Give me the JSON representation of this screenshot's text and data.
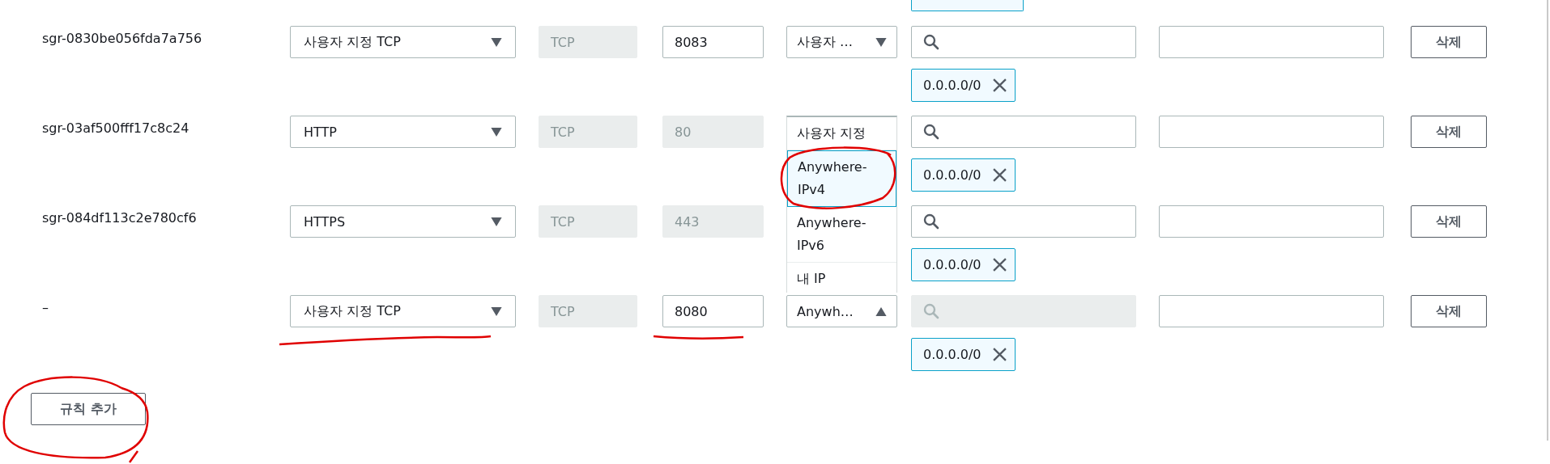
{
  "rules": [
    {
      "id": "sgr-0830be056fda7a756",
      "type": "사용자 지정 TCP",
      "protocol": "TCP",
      "port": {
        "value": "8083",
        "disabled": false
      },
      "source": {
        "value": "사용자 …",
        "expanded": false
      },
      "search_disabled": false,
      "delete": "삭제",
      "tags": [
        {
          "label": "0.0.0.0/0"
        }
      ]
    },
    {
      "id": "sgr-03af500fff17c8c24",
      "type": "HTTP",
      "protocol": "TCP",
      "port": {
        "value": "80",
        "disabled": true
      },
      "search_disabled": false,
      "delete": "삭제",
      "tags": [
        {
          "label": "0.0.0.0/0"
        }
      ]
    },
    {
      "id": "sgr-084df113c2e780cf6",
      "type": "HTTPS",
      "protocol": "TCP",
      "port": {
        "value": "443",
        "disabled": true
      },
      "search_disabled": false,
      "delete": "삭제",
      "tags": [
        {
          "label": "0.0.0.0/0"
        }
      ]
    },
    {
      "id": "–",
      "type": "사용자 지정 TCP",
      "protocol": "TCP",
      "port": {
        "value": "8080",
        "disabled": false
      },
      "source": {
        "value": "Anywh…",
        "expanded": true,
        "options": [
          {
            "label": "사용자 지정",
            "selected": false
          },
          {
            "label": "Anywhere-IPv4",
            "selected": true
          },
          {
            "label": "Anywhere-IPv6",
            "selected": false
          },
          {
            "label": "내 IP",
            "selected": false
          }
        ]
      },
      "search_disabled": true,
      "delete": "삭제",
      "tags": [
        {
          "label": "0.0.0.0/0"
        }
      ]
    }
  ],
  "add_rule_button": "규칙 추가"
}
